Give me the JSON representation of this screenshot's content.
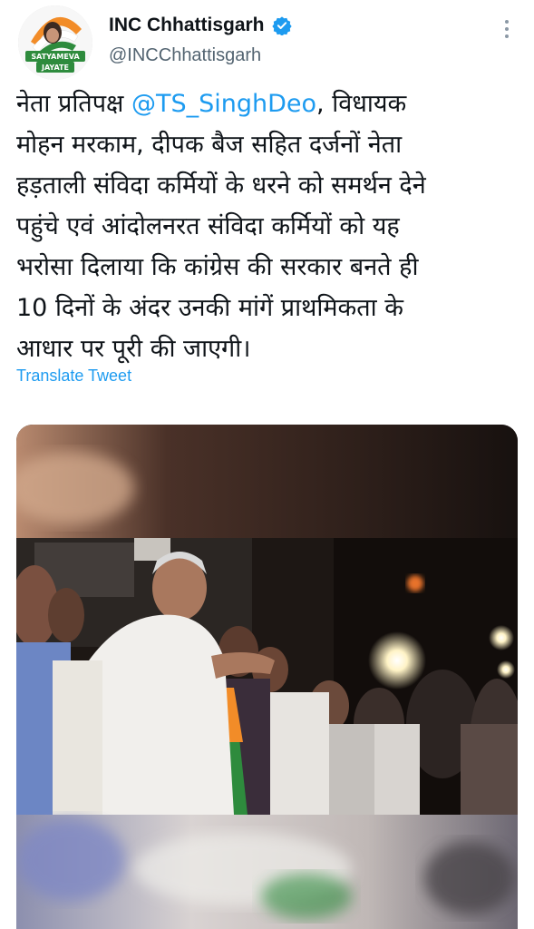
{
  "account": {
    "display_name": "INC Chhattisgarh",
    "handle": "@INCChhattisgarh",
    "verified": true,
    "avatar_text_line1": "SATYAMEVA",
    "avatar_text_line2": "JAYATE"
  },
  "tweet": {
    "line1_pre": "नेता प्रतिपक्ष ",
    "line1_mention": "@TS_SinghDeo",
    "line1_post": ", विधायक",
    "line2": "मोहन मरकाम, दीपक बैज सहित दर्जनों नेता",
    "line3": "हड़ताली संविदा कर्मियों के धरने को समर्थन देने",
    "line4": "पहुंचे एवं आंदोलनरत संविदा कर्मियों को यह",
    "line5": "भरोसा दिलाया कि कांग्रेस की सरकार बनते ही",
    "line6": "10 दिनों के अंदर उनकी मांगें प्राथमिकता के",
    "line7": "आधार पर पूरी की जाएगी।",
    "translate_label": "Translate Tweet"
  },
  "icons": {
    "verified": "verified-badge-icon",
    "more": "more-options-icon"
  },
  "colors": {
    "accent": "#1d9bf0",
    "text": "#0f1419",
    "secondary": "#536471",
    "saffron": "#f28c28",
    "green": "#2e8b3d"
  }
}
